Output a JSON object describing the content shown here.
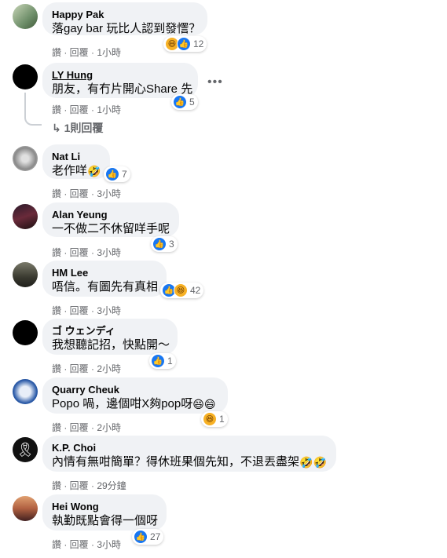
{
  "comments": [
    {
      "name": "Happy Pak",
      "text": "落gay bar 玩比人認到發㦒？",
      "actions": "讚 · 回覆 · 1小時",
      "reaction_count": "12"
    },
    {
      "name": "LY Hung",
      "text": "朋友，有冇片開心Share 先",
      "actions": "讚 · 回覆 · 1小時",
      "reaction_count": "5",
      "more": "•••",
      "replies_label": "1則回覆",
      "replies_arrow": "↳"
    },
    {
      "name": "Nat Li",
      "text": "老作咩",
      "actions": "讚 · 回覆 · 3小時",
      "reaction_count": "7"
    },
    {
      "name": "Alan Yeung",
      "text": "一不做二不休留咩手呢",
      "actions": "讚 · 回覆 · 3小時",
      "reaction_count": "3"
    },
    {
      "name": "HM Lee",
      "text": "唔信。有圖先有真相",
      "actions": "讚 · 回覆 · 3小時",
      "reaction_count": "42"
    },
    {
      "name": "ゴ ウェンディ",
      "text": "我想聽記招，快點開～",
      "actions": "讚 · 回覆 · 2小時",
      "reaction_count": "1"
    },
    {
      "name": "Quarry Cheuk",
      "text": "Popo 喎，邊個咁X夠pop呀",
      "actions": "讚 · 回覆 · 2小時",
      "reaction_count": "1"
    },
    {
      "name": "K.P. Choi",
      "text": "內情有無咁簡單？得休班果個先知，不退丟盡架",
      "actions": "讚 · 回覆 · 29分鐘",
      "reaction_count": ""
    },
    {
      "name": "Hei Wong",
      "text": "執勤既點會得一個呀",
      "actions": "讚 · 回覆 · 3小時",
      "reaction_count": "27"
    }
  ],
  "icons": {
    "like": "like-icon",
    "haha": "haha-icon",
    "laugh": "laugh-emoji"
  },
  "colors": {
    "bubble": "#f0f2f5",
    "meta": "#65676b",
    "like": "#1877f2",
    "haha": "#f7b125"
  }
}
